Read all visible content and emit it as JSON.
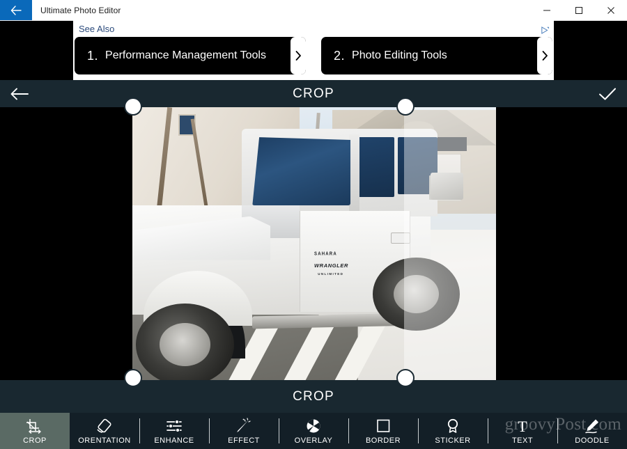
{
  "window": {
    "title": "Ultimate Photo Editor",
    "back_icon": "arrow-left-icon",
    "minimize_label": "—",
    "maximize_label": "□",
    "close_label": "✕"
  },
  "ad": {
    "heading": "See Also",
    "adchoices_label": "AdChoices",
    "cards": [
      {
        "number": "1",
        "label": "Performance Management Tools",
        "go_label": "›"
      },
      {
        "number": "2",
        "label": "Photo Editing Tools",
        "go_label": "›"
      }
    ]
  },
  "editor_header": {
    "back_icon": "arrow-left-icon",
    "title": "CROP",
    "confirm_icon": "check-icon"
  },
  "canvas": {
    "mode_label": "CROP",
    "photo_alt": "white-jeep-wrangler-unlimited-sahara-in-driveway",
    "jeep_badges": {
      "model_top": "SAHARA",
      "model": "WRANGLER",
      "model_sub": "UNLIMITED"
    },
    "handles": [
      "crop-handle-top-left",
      "crop-handle-top-right",
      "crop-handle-bottom-left",
      "crop-handle-bottom-right"
    ]
  },
  "toolbar": {
    "items": [
      {
        "label": "CROP",
        "icon": "crop-icon",
        "active": true
      },
      {
        "label": "ORENTATION",
        "icon": "rotate-icon",
        "active": false
      },
      {
        "label": "ENHANCE",
        "icon": "sliders-icon",
        "active": false
      },
      {
        "label": "EFFECT",
        "icon": "magic-wand-icon",
        "active": false
      },
      {
        "label": "OVERLAY",
        "icon": "overlay-icon",
        "active": false
      },
      {
        "label": "BORDER",
        "icon": "square-icon",
        "active": false
      },
      {
        "label": "STICKER",
        "icon": "badge-icon",
        "active": false
      },
      {
        "label": "TEXT",
        "icon": "text-t-icon",
        "active": false
      },
      {
        "label": "DOODLE",
        "icon": "pencil-icon",
        "active": false
      }
    ]
  },
  "watermark": {
    "text": "groovyPost.com"
  },
  "colors": {
    "titlebar_bg": "#ffffff",
    "back_button_bg": "#0a69ba",
    "header_bg": "#192830",
    "toolbar_bg": "#131f27",
    "active_tool_bg": "#5a6a64",
    "canvas_bg": "#000000",
    "ad_card_bg": "#000000",
    "ad_link": "#2c4b7c"
  }
}
